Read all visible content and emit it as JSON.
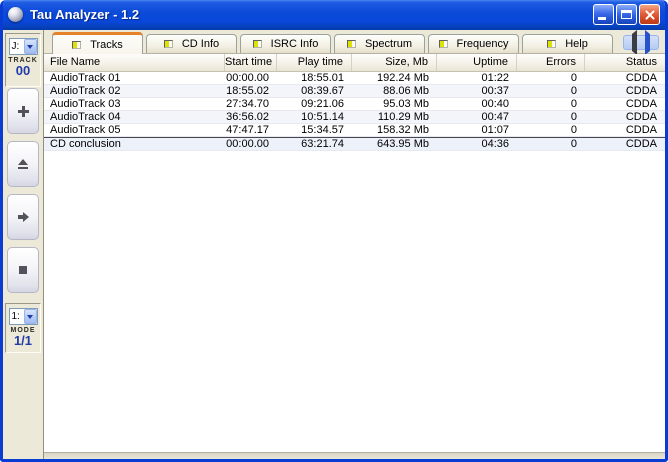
{
  "window": {
    "title": "Tau Analyzer - 1.2"
  },
  "colors": {
    "titlebar_blue": "#0c4ad8",
    "window_border": "#0a3cd4",
    "panel_beige": "#ece9d8",
    "active_tab_accent": "#e5822a",
    "tab_icon_yellow": "#dde204",
    "value_blue": "#2239a8",
    "close_button_red": "#cc4420",
    "row_alt": "#f4f4fb"
  },
  "icons": {
    "app": "sphere-icon",
    "window_controls": [
      "minimize-icon",
      "maximize-icon",
      "close-icon"
    ],
    "tab": "form-icon",
    "tab_scroll": [
      "arrow-left-icon",
      "arrow-right-icon"
    ],
    "sidebar_buttons": [
      "plus-icon",
      "eject-icon",
      "arrow-right-icon",
      "stop-icon"
    ],
    "dropdowns": "chevron-down-icon"
  },
  "tabs": [
    {
      "label": "Tracks",
      "active": true
    },
    {
      "label": "CD Info",
      "active": false
    },
    {
      "label": "ISRC Info",
      "active": false
    },
    {
      "label": "Spectrum",
      "active": false
    },
    {
      "label": "Frequency",
      "active": false
    },
    {
      "label": "Help",
      "active": false
    }
  ],
  "sidebar": {
    "drive": {
      "value": "J:",
      "label": "TRACK",
      "number": "00"
    },
    "mode": {
      "value": "1:",
      "label": "MODE",
      "number": "1/1"
    }
  },
  "table": {
    "columns": [
      "File Name",
      "Start time",
      "Play time",
      "Size, Mb",
      "Uptime",
      "Errors",
      "Status"
    ],
    "rows": [
      {
        "name": "AudioTrack 01",
        "start": "00:00.00",
        "play": "18:55.01",
        "size": "192.24 Mb",
        "uptime": "01:22",
        "errors": "0",
        "status": "CDDA"
      },
      {
        "name": "AudioTrack 02",
        "start": "18:55.02",
        "play": "08:39.67",
        "size": "88.06 Mb",
        "uptime": "00:37",
        "errors": "0",
        "status": "CDDA"
      },
      {
        "name": "AudioTrack 03",
        "start": "27:34.70",
        "play": "09:21.06",
        "size": "95.03 Mb",
        "uptime": "00:40",
        "errors": "0",
        "status": "CDDA"
      },
      {
        "name": "AudioTrack 04",
        "start": "36:56.02",
        "play": "10:51.14",
        "size": "110.29 Mb",
        "uptime": "00:47",
        "errors": "0",
        "status": "CDDA"
      },
      {
        "name": "AudioTrack 05",
        "start": "47:47.17",
        "play": "15:34.57",
        "size": "158.32 Mb",
        "uptime": "01:07",
        "errors": "0",
        "status": "CDDA"
      },
      {
        "name": "CD conclusion",
        "start": "00:00.00",
        "play": "63:21.74",
        "size": "643.95 Mb",
        "uptime": "04:36",
        "errors": "0",
        "status": "CDDA",
        "summary": true
      }
    ]
  }
}
